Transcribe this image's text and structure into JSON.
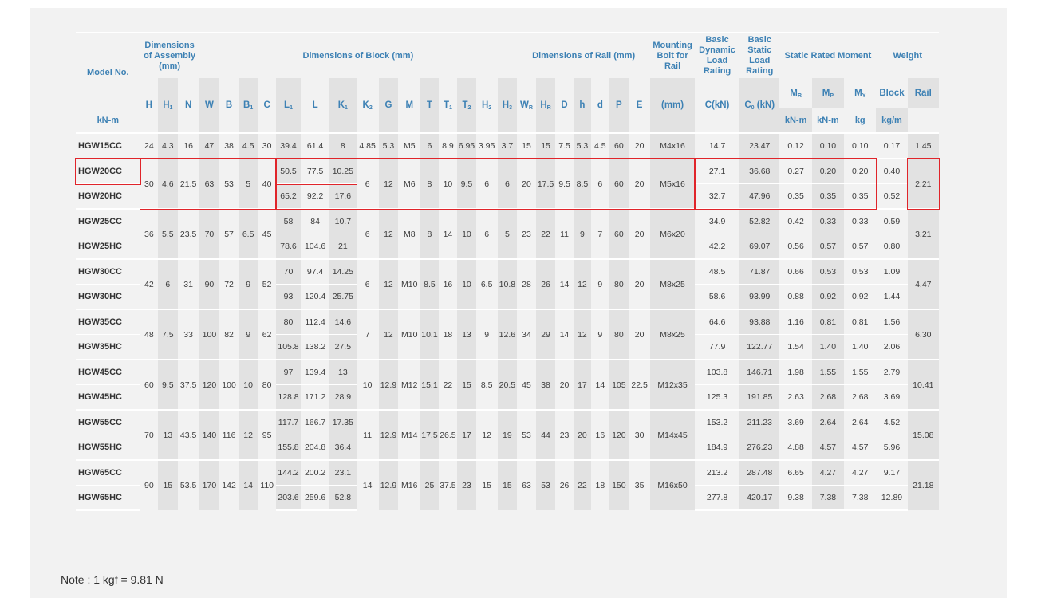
{
  "header": {
    "model_no": "Model No.",
    "assembly": "Dimensions of Assembly (mm)",
    "block": "Dimensions of Block (mm)",
    "rail": "Dimensions of Rail (mm)",
    "bolt": "Mounting Bolt for Rail",
    "dynamic": "Basic Dynamic Load Rating",
    "static": "Basic Static Load Rating",
    "moment": "Static Rated Moment",
    "weight": "Weight",
    "block_w": "Block",
    "rail_w": "Rail",
    "sym": {
      "H": "H",
      "H1": "H",
      "H1s": "1",
      "N": "N",
      "W": "W",
      "B": "B",
      "B1": "B",
      "B1s": "1",
      "C": "C",
      "L1": "L",
      "L1s": "1",
      "L": "L",
      "K1": "K",
      "K1s": "1",
      "K2": "K",
      "K2s": "2",
      "G": "G",
      "M": "M",
      "T": "T",
      "T1": "T",
      "T1s": "1",
      "T2": "T",
      "T2s": "2",
      "H2": "H",
      "H2s": "2",
      "H3": "H",
      "H3s": "3",
      "WR": "W",
      "WRs": "R",
      "HR": "H",
      "HRs": "R",
      "D": "D",
      "h": "h",
      "d": "d",
      "P": "P",
      "E": "E",
      "mm": "(mm)",
      "C_kN": "C(kN)",
      "C0": "C",
      "C0s": "0",
      "C0u": " (kN)",
      "MR": "M",
      "MRs": "R",
      "MP": "M",
      "MPs": "P",
      "MY": "M",
      "MYs": "Y",
      "kNm": "kN-m",
      "kg": "kg",
      "kgm": "kg/m"
    }
  },
  "rows": [
    {
      "model": "HGW15CC",
      "H": "24",
      "H1": "4.3",
      "N": "16",
      "W": "47",
      "B": "38",
      "B1": "4.5",
      "C": "30",
      "L1": "39.4",
      "L": "61.4",
      "K1": "8",
      "K2": "4.85",
      "G": "5.3",
      "M": "M5",
      "T": "6",
      "T1": "8.9",
      "T2": "6.95",
      "H2": "3.95",
      "H3": "3.7",
      "WR": "15",
      "HR": "15",
      "D": "7.5",
      "h": "5.3",
      "d": "4.5",
      "P": "60",
      "E": "20",
      "bolt": "M4x16",
      "C_kN": "14.7",
      "C0": "23.47",
      "MR": "0.12",
      "MP": "0.10",
      "MY": "0.10",
      "wb": "0.17",
      "wr": "1.45"
    },
    {
      "model": "HGW20CC",
      "H": "30",
      "H1": "4.6",
      "N": "21.5",
      "W": "63",
      "B": "53",
      "B1": "5",
      "C": "40",
      "L1": "50.5",
      "L": "77.5",
      "K1": "10.25",
      "K2": "6",
      "G": "12",
      "M": "M6",
      "T": "8",
      "T1": "10",
      "T2": "9.5",
      "H2": "6",
      "H3": "6",
      "WR": "20",
      "HR": "17.5",
      "D": "9.5",
      "h": "8.5",
      "d": "6",
      "P": "60",
      "E": "20",
      "bolt": "M5x16",
      "C_kN": "27.1",
      "C0": "36.68",
      "MR": "0.27",
      "MP": "0.20",
      "MY": "0.20",
      "wb": "0.40",
      "wr": "2.21"
    },
    {
      "model": "HGW20HC",
      "L1": "65.2",
      "L": "92.2",
      "K1": "17.6",
      "C_kN": "32.7",
      "C0": "47.96",
      "MR": "0.35",
      "MP": "0.35",
      "MY": "0.35",
      "wb": "0.52"
    },
    {
      "model": "HGW25CC",
      "H": "36",
      "H1": "5.5",
      "N": "23.5",
      "W": "70",
      "B": "57",
      "B1": "6.5",
      "C": "45",
      "L1": "58",
      "L": "84",
      "K1": "10.7",
      "K2": "6",
      "G": "12",
      "M": "M8",
      "T": "8",
      "T1": "14",
      "T2": "10",
      "H2": "6",
      "H3": "5",
      "WR": "23",
      "HR": "22",
      "D": "11",
      "h": "9",
      "d": "7",
      "P": "60",
      "E": "20",
      "bolt": "M6x20",
      "C_kN": "34.9",
      "C0": "52.82",
      "MR": "0.42",
      "MP": "0.33",
      "MY": "0.33",
      "wb": "0.59",
      "wr": "3.21"
    },
    {
      "model": "HGW25HC",
      "L1": "78.6",
      "L": "104.6",
      "K1": "21",
      "C_kN": "42.2",
      "C0": "69.07",
      "MR": "0.56",
      "MP": "0.57",
      "MY": "0.57",
      "wb": "0.80"
    },
    {
      "model": "HGW30CC",
      "H": "42",
      "H1": "6",
      "N": "31",
      "W": "90",
      "B": "72",
      "B1": "9",
      "C": "52",
      "L1": "70",
      "L": "97.4",
      "K1": "14.25",
      "K2": "6",
      "G": "12",
      "M": "M10",
      "T": "8.5",
      "T1": "16",
      "T2": "10",
      "H2": "6.5",
      "H3": "10.8",
      "WR": "28",
      "HR": "26",
      "D": "14",
      "h": "12",
      "d": "9",
      "P": "80",
      "E": "20",
      "bolt": "M8x25",
      "C_kN": "48.5",
      "C0": "71.87",
      "MR": "0.66",
      "MP": "0.53",
      "MY": "0.53",
      "wb": "1.09",
      "wr": "4.47"
    },
    {
      "model": "HGW30HC",
      "L1": "93",
      "L": "120.4",
      "K1": "25.75",
      "C_kN": "58.6",
      "C0": "93.99",
      "MR": "0.88",
      "MP": "0.92",
      "MY": "0.92",
      "wb": "1.44"
    },
    {
      "model": "HGW35CC",
      "H": "48",
      "H1": "7.5",
      "N": "33",
      "W": "100",
      "B": "82",
      "B1": "9",
      "C": "62",
      "L1": "80",
      "L": "112.4",
      "K1": "14.6",
      "K2": "7",
      "G": "12",
      "M": "M10",
      "T": "10.1",
      "T1": "18",
      "T2": "13",
      "H2": "9",
      "H3": "12.6",
      "WR": "34",
      "HR": "29",
      "D": "14",
      "h": "12",
      "d": "9",
      "P": "80",
      "E": "20",
      "bolt": "M8x25",
      "C_kN": "64.6",
      "C0": "93.88",
      "MR": "1.16",
      "MP": "0.81",
      "MY": "0.81",
      "wb": "1.56",
      "wr": "6.30"
    },
    {
      "model": "HGW35HC",
      "L1": "105.8",
      "L": "138.2",
      "K1": "27.5",
      "C_kN": "77.9",
      "C0": "122.77",
      "MR": "1.54",
      "MP": "1.40",
      "MY": "1.40",
      "wb": "2.06"
    },
    {
      "model": "HGW45CC",
      "H": "60",
      "H1": "9.5",
      "N": "37.5",
      "W": "120",
      "B": "100",
      "B1": "10",
      "C": "80",
      "L1": "97",
      "L": "139.4",
      "K1": "13",
      "K2": "10",
      "G": "12.9",
      "M": "M12",
      "T": "15.1",
      "T1": "22",
      "T2": "15",
      "H2": "8.5",
      "H3": "20.5",
      "WR": "45",
      "HR": "38",
      "D": "20",
      "h": "17",
      "d": "14",
      "P": "105",
      "E": "22.5",
      "bolt": "M12x35",
      "C_kN": "103.8",
      "C0": "146.71",
      "MR": "1.98",
      "MP": "1.55",
      "MY": "1.55",
      "wb": "2.79",
      "wr": "10.41"
    },
    {
      "model": "HGW45HC",
      "L1": "128.8",
      "L": "171.2",
      "K1": "28.9",
      "C_kN": "125.3",
      "C0": "191.85",
      "MR": "2.63",
      "MP": "2.68",
      "MY": "2.68",
      "wb": "3.69"
    },
    {
      "model": "HGW55CC",
      "H": "70",
      "H1": "13",
      "N": "43.5",
      "W": "140",
      "B": "116",
      "B1": "12",
      "C": "95",
      "L1": "117.7",
      "L": "166.7",
      "K1": "17.35",
      "K2": "11",
      "G": "12.9",
      "M": "M14",
      "T": "17.5",
      "T1": "26.5",
      "T2": "17",
      "H2": "12",
      "H3": "19",
      "WR": "53",
      "HR": "44",
      "D": "23",
      "h": "20",
      "d": "16",
      "P": "120",
      "E": "30",
      "bolt": "M14x45",
      "C_kN": "153.2",
      "C0": "211.23",
      "MR": "3.69",
      "MP": "2.64",
      "MY": "2.64",
      "wb": "4.52",
      "wr": "15.08"
    },
    {
      "model": "HGW55HC",
      "L1": "155.8",
      "L": "204.8",
      "K1": "36.4",
      "C_kN": "184.9",
      "C0": "276.23",
      "MR": "4.88",
      "MP": "4.57",
      "MY": "4.57",
      "wb": "5.96"
    },
    {
      "model": "HGW65CC",
      "H": "90",
      "H1": "15",
      "N": "53.5",
      "W": "170",
      "B": "142",
      "B1": "14",
      "C": "110",
      "L1": "144.2",
      "L": "200.2",
      "K1": "23.1",
      "K2": "14",
      "G": "12.9",
      "M": "M16",
      "T": "25",
      "T1": "37.5",
      "T2": "23",
      "H2": "15",
      "H3": "15",
      "WR": "63",
      "HR": "53",
      "D": "26",
      "h": "22",
      "d": "18",
      "P": "150",
      "E": "35",
      "bolt": "M16x50",
      "C_kN": "213.2",
      "C0": "287.48",
      "MR": "6.65",
      "MP": "4.27",
      "MY": "4.27",
      "wb": "9.17",
      "wr": "21.18"
    },
    {
      "model": "HGW65HC",
      "L1": "203.6",
      "L": "259.6",
      "K1": "52.8",
      "C_kN": "277.8",
      "C0": "420.17",
      "MR": "9.38",
      "MP": "7.38",
      "MY": "7.38",
      "wb": "12.89"
    }
  ],
  "note": "Note : 1 kgf = 9.81 N",
  "highlight_color": "#e0242a"
}
